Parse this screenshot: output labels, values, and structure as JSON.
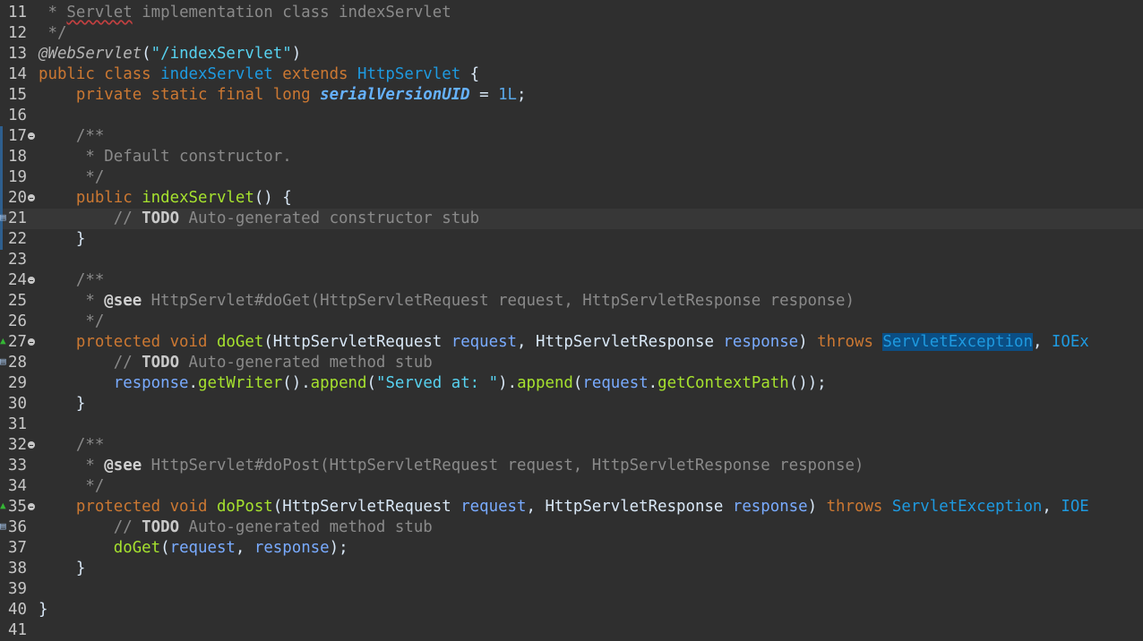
{
  "editor": {
    "language": "java",
    "current_line": 21,
    "lines": [
      {
        "n": "11",
        "tokens": [
          {
            "t": " * ",
            "k": "javadoc"
          },
          {
            "t": "Servlet",
            "k": "javadoc",
            "spell": true
          },
          {
            "t": " implementation class indexServlet",
            "k": "javadoc"
          }
        ]
      },
      {
        "n": "12",
        "tokens": [
          {
            "t": " */",
            "k": "javadoc"
          }
        ]
      },
      {
        "n": "13",
        "tokens": [
          {
            "t": "@WebServlet",
            "k": "annotation"
          },
          {
            "t": "(",
            "k": "plain"
          },
          {
            "t": "\"/indexServlet\"",
            "k": "string"
          },
          {
            "t": ")",
            "k": "plain"
          }
        ]
      },
      {
        "n": "14",
        "tokens": [
          {
            "t": "public class ",
            "k": "keyword"
          },
          {
            "t": "indexServlet",
            "k": "class"
          },
          {
            "t": " extends ",
            "k": "keyword"
          },
          {
            "t": "HttpServlet",
            "k": "class"
          },
          {
            "t": " {",
            "k": "plain"
          }
        ]
      },
      {
        "n": "15",
        "tokens": [
          {
            "t": "    ",
            "k": "plain"
          },
          {
            "t": "private static final long ",
            "k": "keyword"
          },
          {
            "t": "serialVersionUID",
            "k": "field"
          },
          {
            "t": " = ",
            "k": "plain"
          },
          {
            "t": "1L",
            "k": "number"
          },
          {
            "t": ";",
            "k": "plain"
          }
        ]
      },
      {
        "n": "16",
        "tokens": []
      },
      {
        "n": "17",
        "fold": true,
        "mark": true,
        "tokens": [
          {
            "t": "    /**",
            "k": "javadoc"
          }
        ]
      },
      {
        "n": "18",
        "mark": true,
        "tokens": [
          {
            "t": "     * Default constructor.",
            "k": "javadoc"
          }
        ]
      },
      {
        "n": "19",
        "mark": true,
        "tokens": [
          {
            "t": "     */",
            "k": "javadoc"
          }
        ]
      },
      {
        "n": "20",
        "fold": true,
        "mark": true,
        "tokens": [
          {
            "t": "    ",
            "k": "plain"
          },
          {
            "t": "public ",
            "k": "keyword"
          },
          {
            "t": "indexServlet",
            "k": "method"
          },
          {
            "t": "() {",
            "k": "plain"
          }
        ]
      },
      {
        "n": "21",
        "icon": "task",
        "mark": true,
        "tokens": [
          {
            "t": "        // ",
            "k": "comment"
          },
          {
            "t": "TODO",
            "k": "todo"
          },
          {
            "t": " Auto-generated constructor stub",
            "k": "comment"
          }
        ]
      },
      {
        "n": "22",
        "mark": true,
        "tokens": [
          {
            "t": "    }",
            "k": "plain"
          }
        ]
      },
      {
        "n": "23",
        "tokens": []
      },
      {
        "n": "24",
        "fold": true,
        "tokens": [
          {
            "t": "    /**",
            "k": "javadoc"
          }
        ]
      },
      {
        "n": "25",
        "tokens": [
          {
            "t": "     * ",
            "k": "javadoc"
          },
          {
            "t": "@see",
            "k": "jdtag"
          },
          {
            "t": " HttpServlet#doGet(HttpServletRequest request, HttpServletResponse response)",
            "k": "javadoc"
          }
        ]
      },
      {
        "n": "26",
        "tokens": [
          {
            "t": "     */",
            "k": "javadoc"
          }
        ]
      },
      {
        "n": "27",
        "fold": true,
        "icon": "override",
        "tokens": [
          {
            "t": "    ",
            "k": "plain"
          },
          {
            "t": "protected void ",
            "k": "keyword"
          },
          {
            "t": "doGet",
            "k": "method"
          },
          {
            "t": "(",
            "k": "plain"
          },
          {
            "t": "HttpServletRequest",
            "k": "plain"
          },
          {
            "t": " request",
            "k": "param"
          },
          {
            "t": ", ",
            "k": "plain"
          },
          {
            "t": "HttpServletResponse",
            "k": "plain"
          },
          {
            "t": " response",
            "k": "param"
          },
          {
            "t": ") ",
            "k": "plain"
          },
          {
            "t": "throws ",
            "k": "keyword"
          },
          {
            "t": "ServletException",
            "k": "selected"
          },
          {
            "t": ", ",
            "k": "plain"
          },
          {
            "t": "IOEx",
            "k": "class"
          }
        ]
      },
      {
        "n": "28",
        "icon": "task",
        "tokens": [
          {
            "t": "        // ",
            "k": "comment"
          },
          {
            "t": "TODO",
            "k": "todo"
          },
          {
            "t": " Auto-generated method stub",
            "k": "comment"
          }
        ]
      },
      {
        "n": "29",
        "tokens": [
          {
            "t": "        ",
            "k": "plain"
          },
          {
            "t": "response",
            "k": "param"
          },
          {
            "t": ".",
            "k": "plain"
          },
          {
            "t": "getWriter",
            "k": "method"
          },
          {
            "t": "().",
            "k": "plain"
          },
          {
            "t": "append",
            "k": "method"
          },
          {
            "t": "(",
            "k": "plain"
          },
          {
            "t": "\"Served at: \"",
            "k": "string"
          },
          {
            "t": ").",
            "k": "plain"
          },
          {
            "t": "append",
            "k": "method"
          },
          {
            "t": "(",
            "k": "plain"
          },
          {
            "t": "request",
            "k": "param"
          },
          {
            "t": ".",
            "k": "plain"
          },
          {
            "t": "getContextPath",
            "k": "method"
          },
          {
            "t": "());",
            "k": "plain"
          }
        ]
      },
      {
        "n": "30",
        "tokens": [
          {
            "t": "    }",
            "k": "plain"
          }
        ]
      },
      {
        "n": "31",
        "tokens": []
      },
      {
        "n": "32",
        "fold": true,
        "tokens": [
          {
            "t": "    /**",
            "k": "javadoc"
          }
        ]
      },
      {
        "n": "33",
        "tokens": [
          {
            "t": "     * ",
            "k": "javadoc"
          },
          {
            "t": "@see",
            "k": "jdtag"
          },
          {
            "t": " HttpServlet#doPost(HttpServletRequest request, HttpServletResponse response)",
            "k": "javadoc"
          }
        ]
      },
      {
        "n": "34",
        "tokens": [
          {
            "t": "     */",
            "k": "javadoc"
          }
        ]
      },
      {
        "n": "35",
        "fold": true,
        "icon": "override",
        "tokens": [
          {
            "t": "    ",
            "k": "plain"
          },
          {
            "t": "protected void ",
            "k": "keyword"
          },
          {
            "t": "doPost",
            "k": "method"
          },
          {
            "t": "(",
            "k": "plain"
          },
          {
            "t": "HttpServletRequest",
            "k": "plain"
          },
          {
            "t": " request",
            "k": "param"
          },
          {
            "t": ", ",
            "k": "plain"
          },
          {
            "t": "HttpServletResponse",
            "k": "plain"
          },
          {
            "t": " response",
            "k": "param"
          },
          {
            "t": ") ",
            "k": "plain"
          },
          {
            "t": "throws ",
            "k": "keyword"
          },
          {
            "t": "ServletException",
            "k": "class"
          },
          {
            "t": ", ",
            "k": "plain"
          },
          {
            "t": "IOE",
            "k": "class"
          }
        ]
      },
      {
        "n": "36",
        "icon": "task",
        "tokens": [
          {
            "t": "        // ",
            "k": "comment"
          },
          {
            "t": "TODO",
            "k": "todo"
          },
          {
            "t": " Auto-generated method stub",
            "k": "comment"
          }
        ]
      },
      {
        "n": "37",
        "tokens": [
          {
            "t": "        ",
            "k": "plain"
          },
          {
            "t": "doGet",
            "k": "method"
          },
          {
            "t": "(",
            "k": "plain"
          },
          {
            "t": "request",
            "k": "param"
          },
          {
            "t": ", ",
            "k": "plain"
          },
          {
            "t": "response",
            "k": "param"
          },
          {
            "t": ");",
            "k": "plain"
          }
        ]
      },
      {
        "n": "38",
        "tokens": [
          {
            "t": "    }",
            "k": "plain"
          }
        ]
      },
      {
        "n": "39",
        "tokens": []
      },
      {
        "n": "40",
        "tokens": [
          {
            "t": "}",
            "k": "plain"
          }
        ]
      },
      {
        "n": "41",
        "tokens": []
      }
    ]
  },
  "icons": {
    "override": "override-triangle-icon",
    "task": "task-marker-icon",
    "fold": "fold-collapse-icon"
  }
}
